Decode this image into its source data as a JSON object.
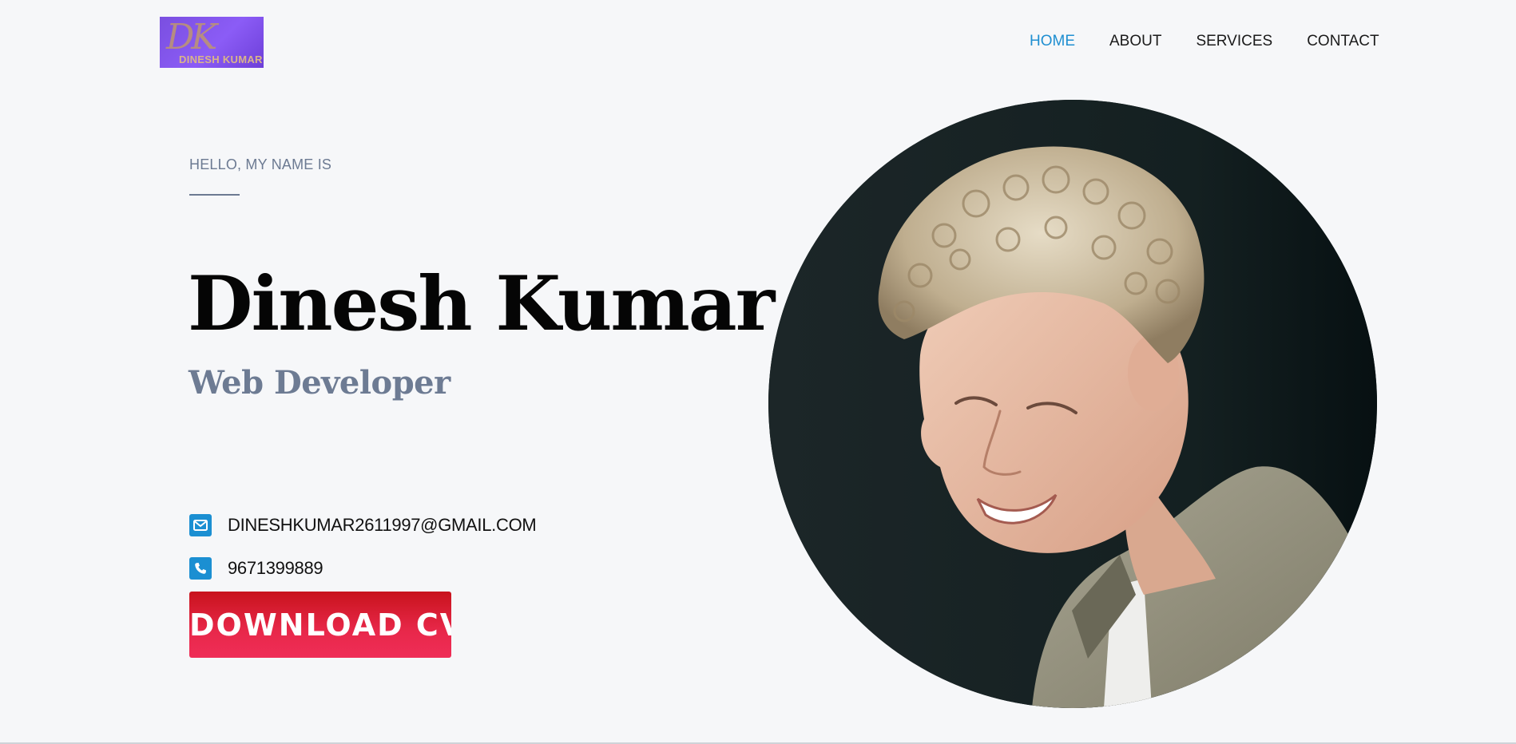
{
  "header": {
    "logo": {
      "mark_text": "DK",
      "text": "DINESH KUMAR",
      "colors": {
        "background": "#7a4fe0",
        "text": "#d9b48a"
      }
    },
    "nav": [
      {
        "label": "HOME",
        "active": true
      },
      {
        "label": "ABOUT",
        "active": false
      },
      {
        "label": "SERVICES",
        "active": false
      },
      {
        "label": "CONTACT",
        "active": false
      }
    ]
  },
  "hero": {
    "greeting": "HELLO, MY NAME IS",
    "name": "Dinesh Kumar",
    "role": "Web Developer",
    "contacts": {
      "email": {
        "icon": "envelope-icon",
        "value": "DINESHKUMAR2611997@GMAIL.COM"
      },
      "phone": {
        "icon": "phone-icon",
        "value": "9671399889"
      }
    },
    "download_label": "DOWNLOAD CV",
    "portrait": {
      "subject": "profile-photo"
    }
  },
  "colors": {
    "accent": "#1f8fd1",
    "muted": "#6c7a92",
    "button": "#e8284a",
    "background": "#f6f7f9"
  }
}
